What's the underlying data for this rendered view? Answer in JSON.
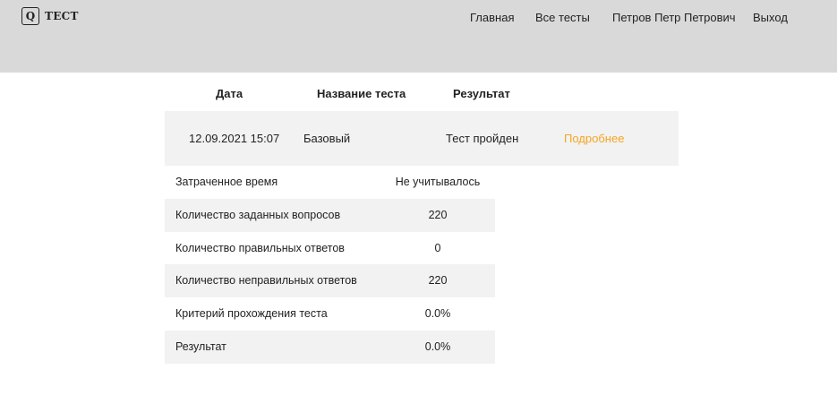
{
  "header": {
    "logo_letter": "Q",
    "logo_text": "ТЕСТ",
    "nav": {
      "home": "Главная",
      "all_tests": "Все тесты",
      "user": "Петров Петр Петрович",
      "logout": "Выход"
    }
  },
  "results_table": {
    "columns": {
      "date": "Дата",
      "test_name": "Название теста",
      "result": "Результат"
    },
    "row": {
      "date": "12.09.2021 15:07",
      "test_name": "Базовый",
      "status": "Тест пройден",
      "details_link": "Подробнее"
    }
  },
  "details": [
    {
      "label": "Затраченное время",
      "value": "Не учитывалось"
    },
    {
      "label": "Количество заданных вопросов",
      "value": "220"
    },
    {
      "label": "Количество правильных ответов",
      "value": "0"
    },
    {
      "label": "Количество неправильных ответов",
      "value": "220"
    },
    {
      "label": "Критерий прохождения теста",
      "value": "0.0%"
    },
    {
      "label": "Результат",
      "value": "0.0%"
    }
  ],
  "colors": {
    "header_bg": "#d9d9d9",
    "row_shade": "#f2f2f2",
    "link_accent": "#f5a623"
  }
}
